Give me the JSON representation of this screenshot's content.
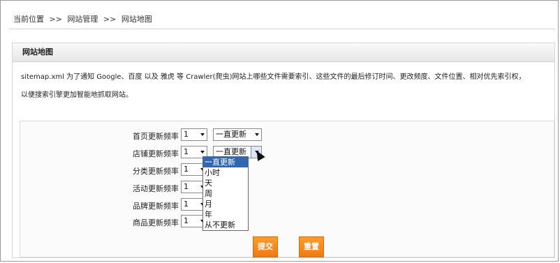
{
  "breadcrumb": {
    "items": [
      "当前位置",
      "网站管理",
      "网站地图"
    ],
    "separator": ">>"
  },
  "panel": {
    "title": "网站地图",
    "description_line1": "sitemap.xml 为了通知 Google、百度 以及 雅虎 等 Crawler(爬虫)网站上哪些文件需要索引、这些文件的最后修订时间、更改频度、文件位置、相对优先索引权，",
    "description_line2": "以便搜索引擎更加智能地抓取网站。"
  },
  "form": {
    "rows": [
      {
        "label": "首页更新频率",
        "priority": "1",
        "frequency": "一直更新"
      },
      {
        "label": "店铺更新频率",
        "priority": "1",
        "frequency": "一直更新"
      },
      {
        "label": "分类更新频率",
        "priority": "1",
        "frequency": ""
      },
      {
        "label": "活动更新频率",
        "priority": "1",
        "frequency": ""
      },
      {
        "label": "品牌更新频率",
        "priority": "1",
        "frequency": ""
      },
      {
        "label": "商品更新频率",
        "priority": "1",
        "frequency": ""
      }
    ],
    "dropdown_options": [
      "一直更新",
      "小时",
      "天",
      "周",
      "月",
      "年",
      "从不更新"
    ],
    "dropdown_selected": "一直更新",
    "submit_label": "提交",
    "reset_label": "重置"
  },
  "colors": {
    "button": "#f58a1e",
    "dropdown_highlight": "#3166b2"
  }
}
